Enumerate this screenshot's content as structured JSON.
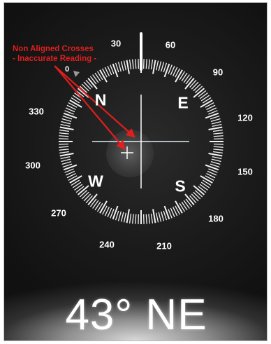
{
  "compass": {
    "degree_labels": [
      "30",
      "60",
      "90",
      "120",
      "150",
      "180",
      "210",
      "240",
      "270",
      "300",
      "330",
      "0"
    ],
    "cardinals": {
      "north": "N",
      "east": "E",
      "south": "S",
      "west": "W"
    },
    "heading": "43° NE"
  },
  "annotation": {
    "line1": "Non Aligned Crosses",
    "line2": "- Inaccurate Reading -",
    "color": "#e01e1e"
  }
}
